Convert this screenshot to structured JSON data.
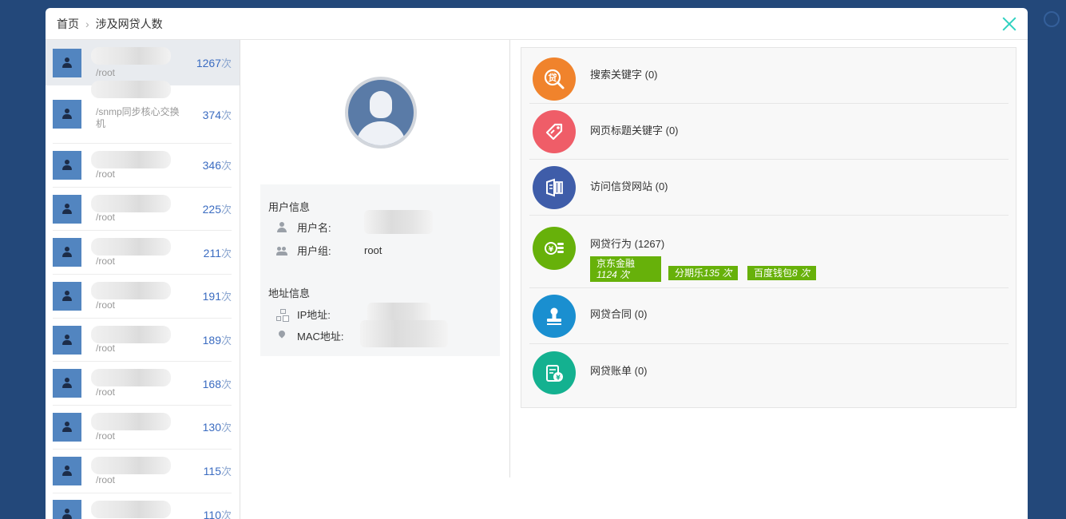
{
  "breadcrumb": {
    "home": "首页",
    "current": "涉及网贷人数"
  },
  "users": [
    {
      "path": "/root",
      "count": "1267",
      "unit": "次"
    },
    {
      "path": "/snmp同步核心交换机",
      "count": "374",
      "unit": "次"
    },
    {
      "path": "/root",
      "count": "346",
      "unit": "次"
    },
    {
      "path": "/root",
      "count": "225",
      "unit": "次"
    },
    {
      "path": "/root",
      "count": "211",
      "unit": "次"
    },
    {
      "path": "/root",
      "count": "191",
      "unit": "次"
    },
    {
      "path": "/root",
      "count": "189",
      "unit": "次"
    },
    {
      "path": "/root",
      "count": "168",
      "unit": "次"
    },
    {
      "path": "/root",
      "count": "130",
      "unit": "次"
    },
    {
      "path": "/root",
      "count": "115",
      "unit": "次"
    },
    {
      "path": "",
      "count": "110",
      "unit": "次"
    }
  ],
  "user_info": {
    "title": "用户信息",
    "username_label": "用户名:",
    "group_label": "用户组:",
    "group_value": "root"
  },
  "address_info": {
    "title": "地址信息",
    "ip_label": "IP地址:",
    "mac_label": "MAC地址:"
  },
  "categories": [
    {
      "label": "搜索关键字 (0)",
      "color": "#f0832c",
      "icon": "loan-search-icon"
    },
    {
      "label": "网页标题关键字 (0)",
      "color": "#ef5d68",
      "icon": "tag-icon"
    },
    {
      "label": "访问信贷网站 (0)",
      "color": "#3f5da9",
      "icon": "website-icon"
    },
    {
      "label": "网贷行为 (1267)",
      "color": "#67b10a",
      "icon": "coins-icon"
    },
    {
      "label": "网贷合同 (0)",
      "color": "#1a8fd0",
      "icon": "stamp-icon"
    },
    {
      "label": "网贷账单 (0)",
      "color": "#14b190",
      "icon": "bill-icon"
    }
  ],
  "behavior_tags": [
    {
      "name": "京东金融",
      "count": "1124 次"
    },
    {
      "name": "分期乐",
      "count": "135 次"
    },
    {
      "name": "百度钱包",
      "count": "8 次"
    }
  ]
}
